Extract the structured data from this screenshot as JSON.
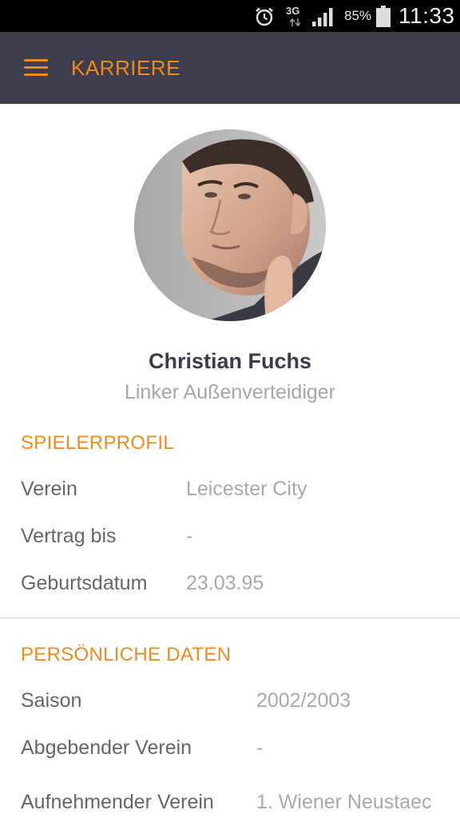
{
  "status_bar": {
    "network": "3G",
    "battery_percent": "85%",
    "time": "11:33",
    "icons": [
      "alarm-icon",
      "network-3g-icon",
      "signal-icon",
      "battery-icon"
    ]
  },
  "app_bar": {
    "menu_icon": "hamburger-menu-icon",
    "title": "KARRIERE",
    "accent_color": "#f08a1c",
    "background_color": "#3d3d4c"
  },
  "profile": {
    "name": "Christian Fuchs",
    "position": "Linker Außenverteidiger"
  },
  "player_profile": {
    "title": "SPIELERPROFIL",
    "rows": [
      {
        "label": "Verein",
        "value": "Leicester City"
      },
      {
        "label": "Vertrag bis",
        "value": "-"
      },
      {
        "label": "Geburtsdatum",
        "value": "23.03.95"
      }
    ]
  },
  "personal_data": {
    "title": "PERSÖNLICHE DATEN",
    "rows": [
      {
        "label": "Saison",
        "value": "2002/2003"
      },
      {
        "label": "Abgebender Verein",
        "value": "-"
      },
      {
        "label": "Aufnehmender Verein",
        "value": "1. Wiener Neustaec"
      }
    ]
  }
}
